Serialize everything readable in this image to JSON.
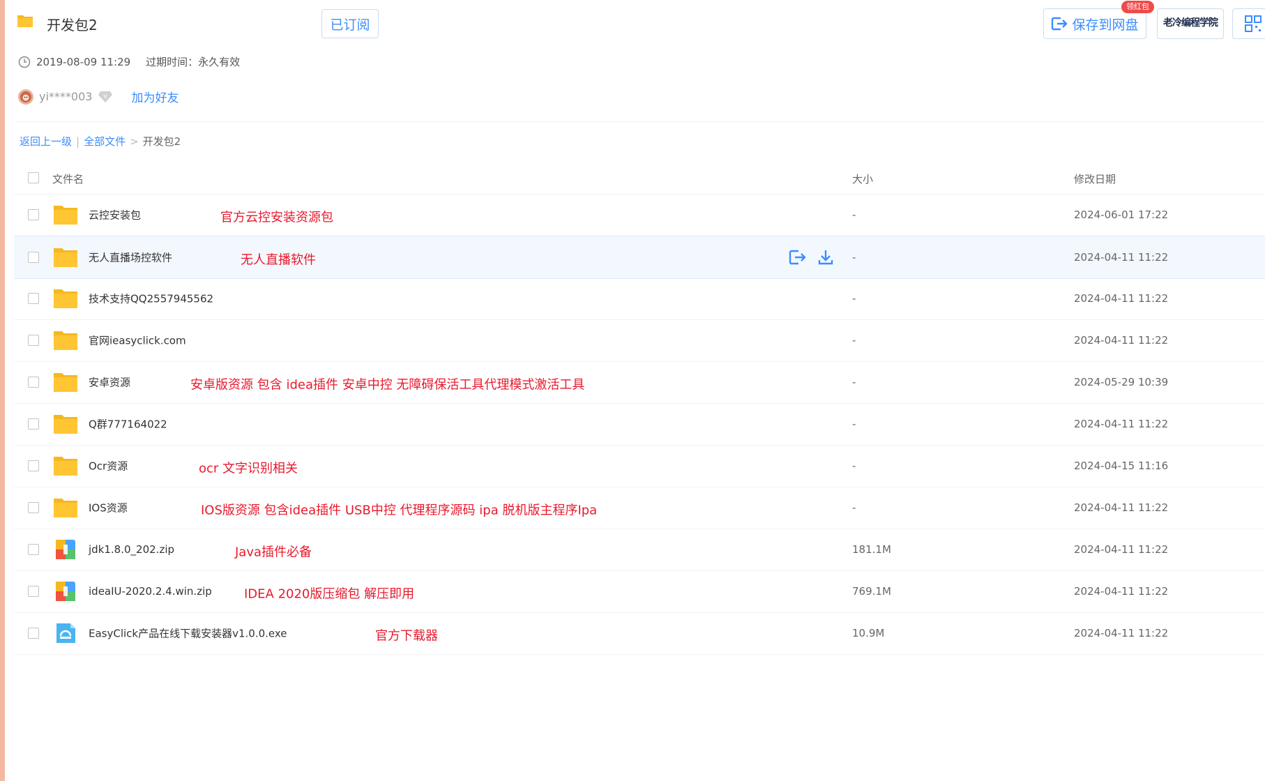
{
  "header": {
    "title": "开发包2",
    "subscribed_label": "已订阅",
    "save_label": "保存到网盘",
    "badge": "领红包",
    "watermark": "老冷编程学院"
  },
  "meta": {
    "date": "2019-08-09 11:29",
    "expiry": "过期时间：永久有效"
  },
  "user": {
    "name": "yi****003",
    "add_friend": "加为好友"
  },
  "breadcrumb": {
    "back": "返回上一级",
    "sep1": "|",
    "all": "全部文件",
    "sep2": ">",
    "current": "开发包2"
  },
  "columns": {
    "name": "文件名",
    "size": "大小",
    "date": "修改日期"
  },
  "files": [
    {
      "name": "云控安装包",
      "note": "官方云控安装资源包",
      "size": "-",
      "date": "2024-06-01 17:22",
      "type": "folder"
    },
    {
      "name": "无人直播场控软件",
      "note": "无人直播软件",
      "size": "-",
      "date": "2024-04-11 11:22",
      "type": "folder"
    },
    {
      "name": "技术支持QQ2557945562",
      "note": "",
      "size": "-",
      "date": "2024-04-11 11:22",
      "type": "folder"
    },
    {
      "name": "官网ieasyclick.com",
      "note": "",
      "size": "-",
      "date": "2024-04-11 11:22",
      "type": "folder"
    },
    {
      "name": "安卓资源",
      "note": "安卓版资源 包含 idea插件  安卓中控 无障碍保活工具代理模式激活工具",
      "size": "-",
      "date": "2024-05-29 10:39",
      "type": "folder"
    },
    {
      "name": "Q群777164022",
      "note": "",
      "size": "-",
      "date": "2024-04-11 11:22",
      "type": "folder"
    },
    {
      "name": "Ocr资源",
      "note": "ocr 文字识别相关",
      "size": "-",
      "date": "2024-04-15 11:16",
      "type": "folder"
    },
    {
      "name": "IOS资源",
      "note": "IOS版资源 包含idea插件 USB中控 代理程序源码 ipa 脱机版主程序Ipa",
      "size": "-",
      "date": "2024-04-11 11:22",
      "type": "folder"
    },
    {
      "name": "jdk1.8.0_202.zip",
      "note": "Java插件必备",
      "size": "181.1M",
      "date": "2024-04-11 11:22",
      "type": "zip"
    },
    {
      "name": "ideaIU-2020.2.4.win.zip",
      "note": "IDEA 2020版压缩包 解压即用",
      "size": "769.1M",
      "date": "2024-04-11 11:22",
      "type": "zip"
    },
    {
      "name": "EasyClick产品在线下载安装器v1.0.0.exe",
      "note": "官方下载器",
      "size": "10.9M",
      "date": "2024-04-11 11:22",
      "type": "exe"
    }
  ],
  "colors": {
    "accent": "#3b8cff",
    "annotation": "#e8192c",
    "folder": "#ffc533"
  }
}
